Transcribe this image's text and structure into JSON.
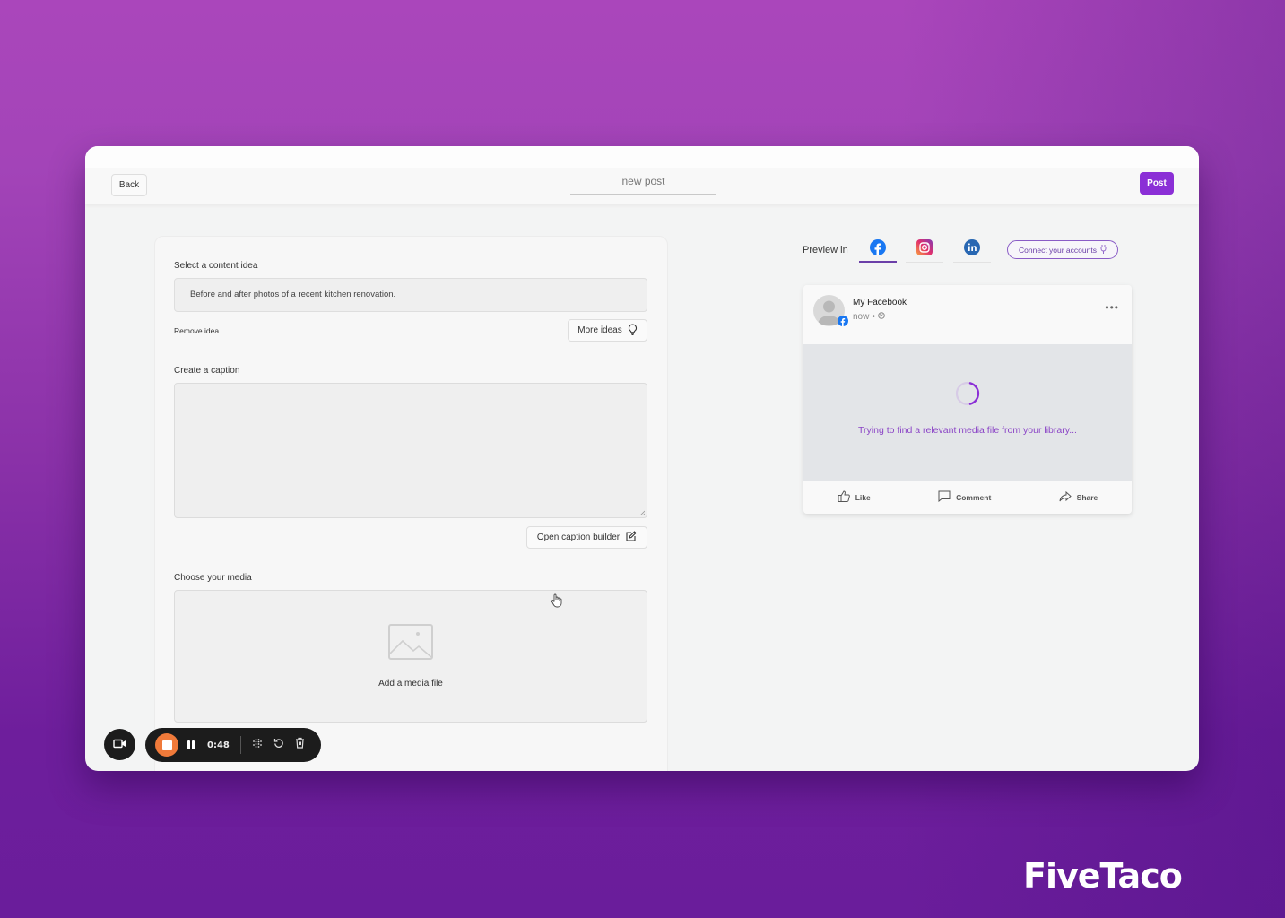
{
  "header": {
    "back_label": "Back",
    "title": "new post",
    "post_label": "Post"
  },
  "colors": {
    "accent": "#8b2fd6",
    "recorder_stop": "#f07a3a",
    "facebook": "#1877f2",
    "linkedin": "#2867b2",
    "loading_text": "#8b45c6"
  },
  "content_idea": {
    "label": "Select a content idea",
    "value": "Before and after photos of a recent kitchen renovation.",
    "remove_label": "Remove idea",
    "more_ideas_label": "More ideas",
    "more_ideas_icon": "lightbulb-icon"
  },
  "caption": {
    "label": "Create a caption",
    "value": "",
    "placeholder": "",
    "builder_label": "Open caption builder",
    "builder_icon": "edit-icon"
  },
  "media": {
    "label": "Choose your media",
    "add_label": "Add a media file",
    "icon": "image-icon"
  },
  "preview": {
    "label": "Preview in",
    "tabs": [
      {
        "name": "facebook",
        "icon": "facebook-icon",
        "active": true
      },
      {
        "name": "instagram",
        "icon": "instagram-icon",
        "active": false
      },
      {
        "name": "linkedin",
        "icon": "linkedin-icon",
        "active": false
      }
    ],
    "connect_label": "Connect your accounts",
    "connect_icon": "plug-icon"
  },
  "facebook_post": {
    "account_name": "My Facebook",
    "time": "now",
    "separator": "•",
    "privacy_icon": "globe-icon",
    "more_icon": "more-icon",
    "more_text": "•••",
    "loading_text": "Trying to find a relevant media file from your library...",
    "actions": [
      {
        "label": "Like",
        "icon": "thumbs-up-icon"
      },
      {
        "label": "Comment",
        "icon": "comment-icon"
      },
      {
        "label": "Share",
        "icon": "share-icon"
      }
    ]
  },
  "recorder": {
    "time": "0:48",
    "camera_icon": "video-camera-icon",
    "stop_icon": "stop-icon",
    "pause_icon": "pause-icon",
    "grid_icon": "grid-icon",
    "restart_icon": "restart-icon",
    "delete_icon": "trash-icon"
  },
  "brand": {
    "name": "FiveTaco"
  }
}
